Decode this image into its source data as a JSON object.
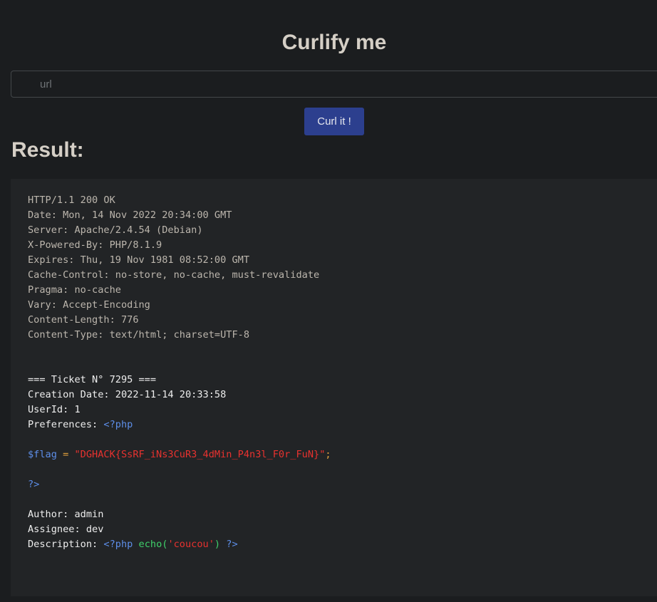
{
  "page": {
    "title": "Curlify me",
    "url_placeholder": "url",
    "curl_button": "Curl it !",
    "result_heading": "Result:"
  },
  "response": {
    "headers": [
      "HTTP/1.1 200 OK",
      "Date: Mon, 14 Nov 2022 20:34:00 GMT",
      "Server: Apache/2.4.54 (Debian)",
      "X-Powered-By: PHP/8.1.9",
      "Expires: Thu, 19 Nov 1981 08:52:00 GMT",
      "Cache-Control: no-store, no-cache, must-revalidate",
      "Pragma: no-cache",
      "Vary: Accept-Encoding",
      "Content-Length: 776",
      "Content-Type: text/html; charset=UTF-8"
    ],
    "ticket_header": "=== Ticket N° 7295 ===",
    "creation_date": "Creation Date: 2022-11-14 20:33:58",
    "user_id": "UserId: 1",
    "preferences_label": "Preferences: ",
    "php_open": "<?php",
    "flag_var": "$flag",
    "flag_op": " = ",
    "flag_value": "\"DGHACK{SsRF_iNs3CuR3_4dMin_P4n3l_F0r_FuN}\"",
    "flag_semicolon": ";",
    "php_close": "?>",
    "author": "Author: admin",
    "assignee": "Assignee: dev",
    "description_label": "Description: ",
    "desc_php_open": "<?php",
    "desc_func": "echo(",
    "desc_string": "'coucou'",
    "desc_func_close": ")",
    "desc_php_close": "?>"
  }
}
